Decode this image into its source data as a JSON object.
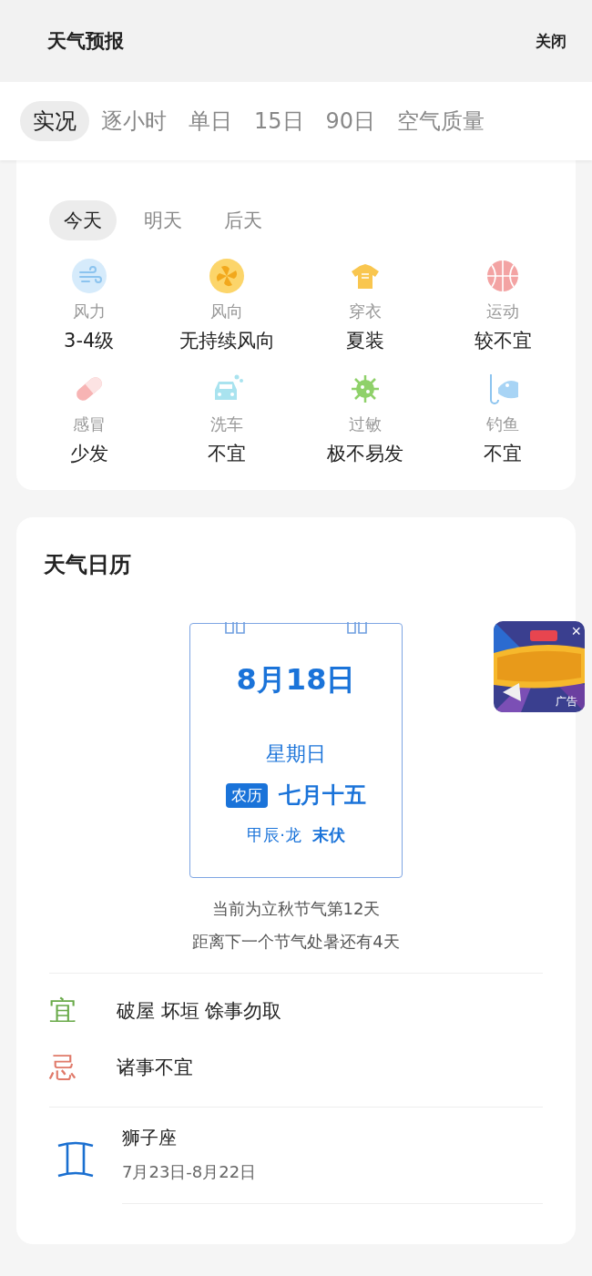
{
  "header": {
    "title": "天气预报",
    "close": "关闭"
  },
  "tabs": [
    {
      "label": "实况",
      "selected": true
    },
    {
      "label": "逐小时",
      "selected": false
    },
    {
      "label": "单日",
      "selected": false
    },
    {
      "label": "15日",
      "selected": false
    },
    {
      "label": "90日",
      "selected": false
    },
    {
      "label": "空气质量",
      "selected": false
    }
  ],
  "life_index": {
    "days": [
      {
        "label": "今天",
        "selected": true
      },
      {
        "label": "明天",
        "selected": false
      },
      {
        "label": "后天",
        "selected": false
      }
    ],
    "items": [
      {
        "name": "风力",
        "value": "3-4级"
      },
      {
        "name": "风向",
        "value": "无持续风向"
      },
      {
        "name": "穿衣",
        "value": "夏装"
      },
      {
        "name": "运动",
        "value": "较不宜"
      },
      {
        "name": "感冒",
        "value": "少发"
      },
      {
        "name": "洗车",
        "value": "不宜"
      },
      {
        "name": "过敏",
        "value": "极不易发"
      },
      {
        "name": "钓鱼",
        "value": "不宜"
      }
    ]
  },
  "calendar": {
    "title": "天气日历",
    "date": "8月18日",
    "weekday": "星期日",
    "lunar_tag": "农历",
    "lunar_date": "七月十五",
    "ganzhi": "甲辰·龙",
    "period": "末伏",
    "solar_term_lines": [
      "当前为立秋节气第12天",
      "距离下一个节气处暑还有4天"
    ],
    "almanac": [
      {
        "kind": "good",
        "mark": "宜",
        "text": "破屋 坏垣 馀事勿取"
      },
      {
        "kind": "bad",
        "mark": "忌",
        "text": "诸事不宜"
      }
    ],
    "zodiac": {
      "name": "狮子座",
      "range": "7月23日-8月22日"
    }
  },
  "ad": {
    "kind": "picture",
    "label": "广告",
    "close": "×"
  }
}
